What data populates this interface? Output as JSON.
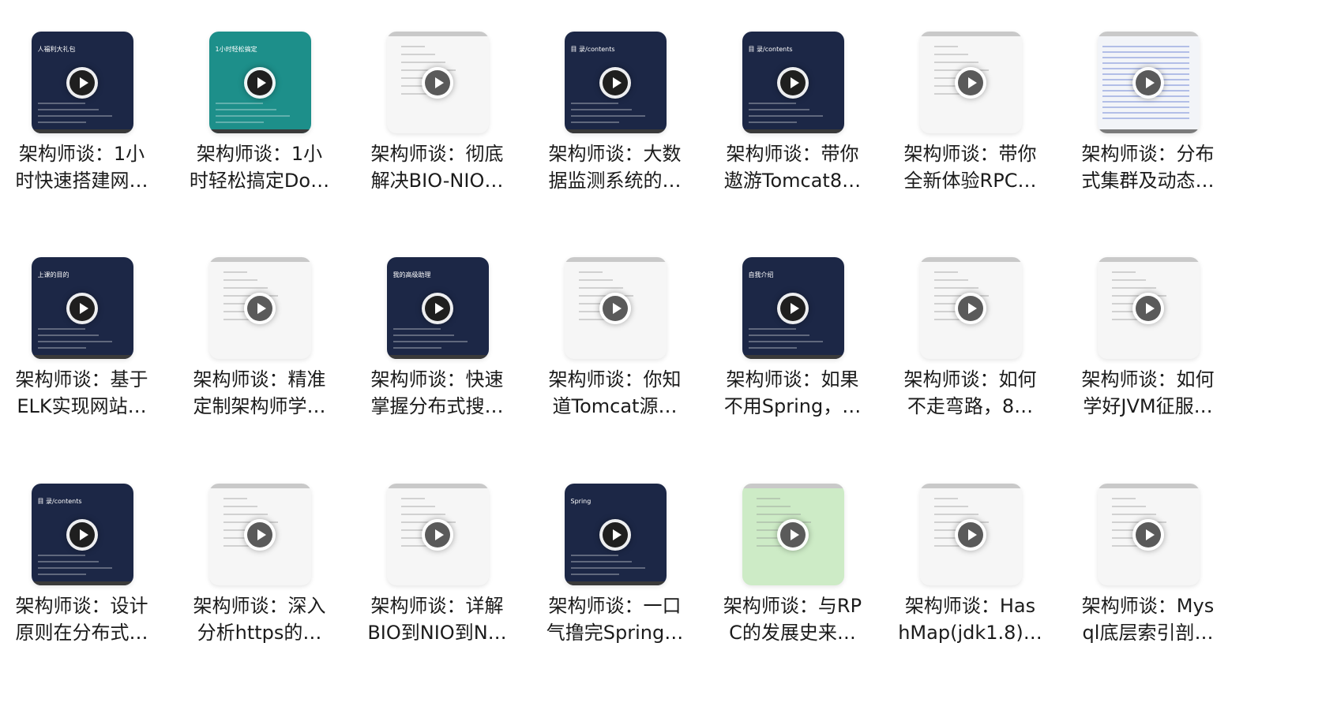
{
  "items": [
    {
      "line1": "架构师谈：1小",
      "line2": "时快速搭建网…",
      "thumb_text": "人福利大礼包"
    },
    {
      "line1": "架构师谈：1小",
      "line2": "时轻松搞定Do…",
      "thumb_text": "1小时轻松搞定"
    },
    {
      "line1": "架构师谈：彻底",
      "line2": "解决BIO-NIO…",
      "thumb_text": ""
    },
    {
      "line1": "架构师谈：大数",
      "line2": "据监测系统的…",
      "thumb_text": "目 录/contents"
    },
    {
      "line1": "架构师谈：带你",
      "line2": "遨游Tomcat8…",
      "thumb_text": "目 录/contents"
    },
    {
      "line1": "架构师谈：带你",
      "line2": "全新体验RPC…",
      "thumb_text": ""
    },
    {
      "line1": "架构师谈：分布",
      "line2": "式集群及动态…",
      "thumb_text": ""
    },
    {
      "line1": "架构师谈：基于",
      "line2": "ELK实现网站…",
      "thumb_text": "上课的目的"
    },
    {
      "line1": "架构师谈：精准",
      "line2": "定制架构师学…",
      "thumb_text": ""
    },
    {
      "line1": "架构师谈：快速",
      "line2": "掌握分布式搜…",
      "thumb_text": "我的高级助理"
    },
    {
      "line1": "架构师谈：你知",
      "line2": "道Tomcat源…",
      "thumb_text": ""
    },
    {
      "line1": "架构师谈：如果",
      "line2": "不用Spring，…",
      "thumb_text": "自我介绍"
    },
    {
      "line1": "架构师谈：如何",
      "line2": "不走弯路，8…",
      "thumb_text": ""
    },
    {
      "line1": "架构师谈：如何",
      "line2": "学好JVM征服…",
      "thumb_text": ""
    },
    {
      "line1": "架构师谈：设计",
      "line2": "原则在分布式…",
      "thumb_text": "目 录/contents"
    },
    {
      "line1": "架构师谈：深入",
      "line2": "分析https的…",
      "thumb_text": ""
    },
    {
      "line1": "架构师谈：详解",
      "line2": "BIO到NIO到N…",
      "thumb_text": ""
    },
    {
      "line1": "架构师谈：一口",
      "line2": "气撸完Spring…",
      "thumb_text": "Spring"
    },
    {
      "line1": "架构师谈：与RP",
      "line2": "C的发展史来…",
      "thumb_text": ""
    },
    {
      "line1": "架构师谈：Has",
      "line2": "hMap(jdk1.8)…",
      "thumb_text": ""
    },
    {
      "line1": "架构师谈：Mys",
      "line2": "ql底层索引剖…",
      "thumb_text": ""
    }
  ],
  "play_icon": "play-icon",
  "colors": {
    "dark_slide": "#1c2746",
    "teal_slide": "#1d8f8a",
    "light_slide": "#f4f4f4",
    "green_slide": "#cdebc6",
    "title_text": "#1b1b1b"
  }
}
